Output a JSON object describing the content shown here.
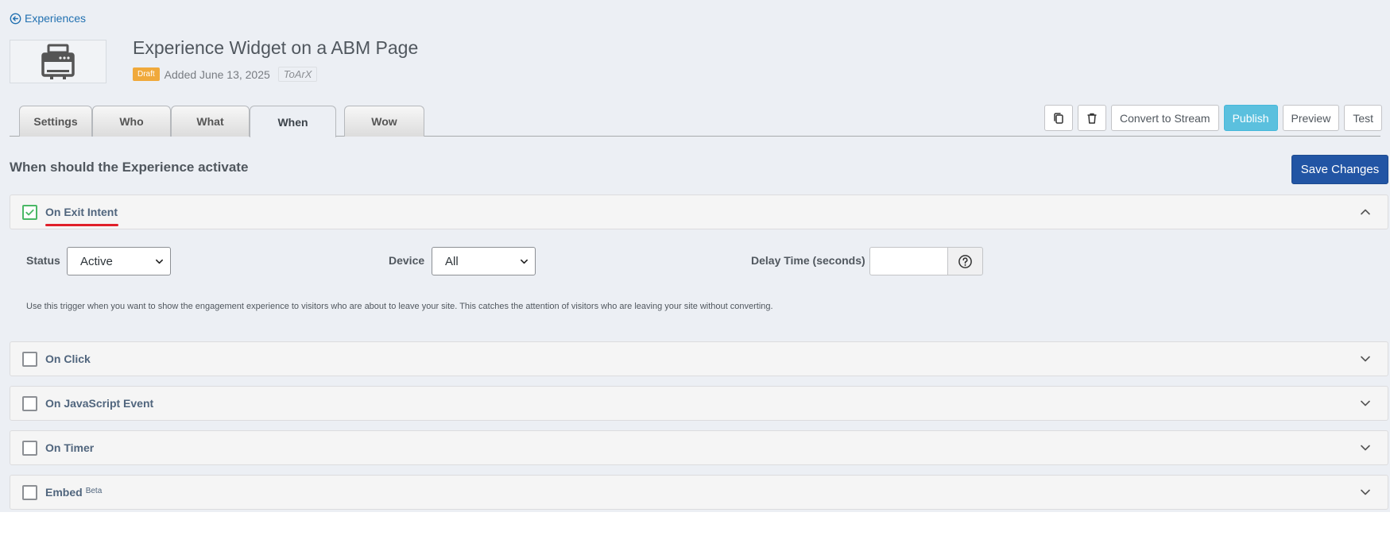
{
  "nav": {
    "back_label": "Experiences"
  },
  "header": {
    "title": "Experience Widget on a ABM Page",
    "status_badge": "Draft",
    "added": "Added June 13, 2025",
    "tag": "ToArX"
  },
  "tabs": [
    {
      "label": "Settings"
    },
    {
      "label": "Who"
    },
    {
      "label": "What"
    },
    {
      "label": "When",
      "active": true
    },
    {
      "label": "Wow"
    }
  ],
  "toolbar": {
    "duplicate_icon": "copy-icon",
    "delete_icon": "trash-icon",
    "convert_label": "Convert to Stream",
    "publish_label": "Publish",
    "preview_label": "Preview",
    "test_label": "Test"
  },
  "section": {
    "title": "When should the Experience activate",
    "save_label": "Save Changes"
  },
  "triggers": {
    "exit_intent": {
      "label": "On Exit Intent",
      "checked": true,
      "expanded": true,
      "status_label": "Status",
      "status_value": "Active",
      "device_label": "Device",
      "device_value": "All",
      "delay_label": "Delay Time (seconds)",
      "delay_value": "",
      "description": "Use this trigger when you want to show the engagement experience to visitors who are about to leave your site. This catches the attention of visitors who are leaving your site without converting."
    },
    "on_click": {
      "label": "On Click",
      "checked": false
    },
    "js_event": {
      "label": "On JavaScript Event",
      "checked": false
    },
    "timer": {
      "label": "On Timer",
      "checked": false
    },
    "embed": {
      "label": "Embed",
      "badge": "Beta",
      "checked": false
    }
  },
  "colors": {
    "link": "#2271b1",
    "draft": "#f0a93b",
    "publish": "#5bc0de",
    "save": "#2255a4",
    "check": "#4ab866",
    "highlight_underline": "#e0202a"
  }
}
